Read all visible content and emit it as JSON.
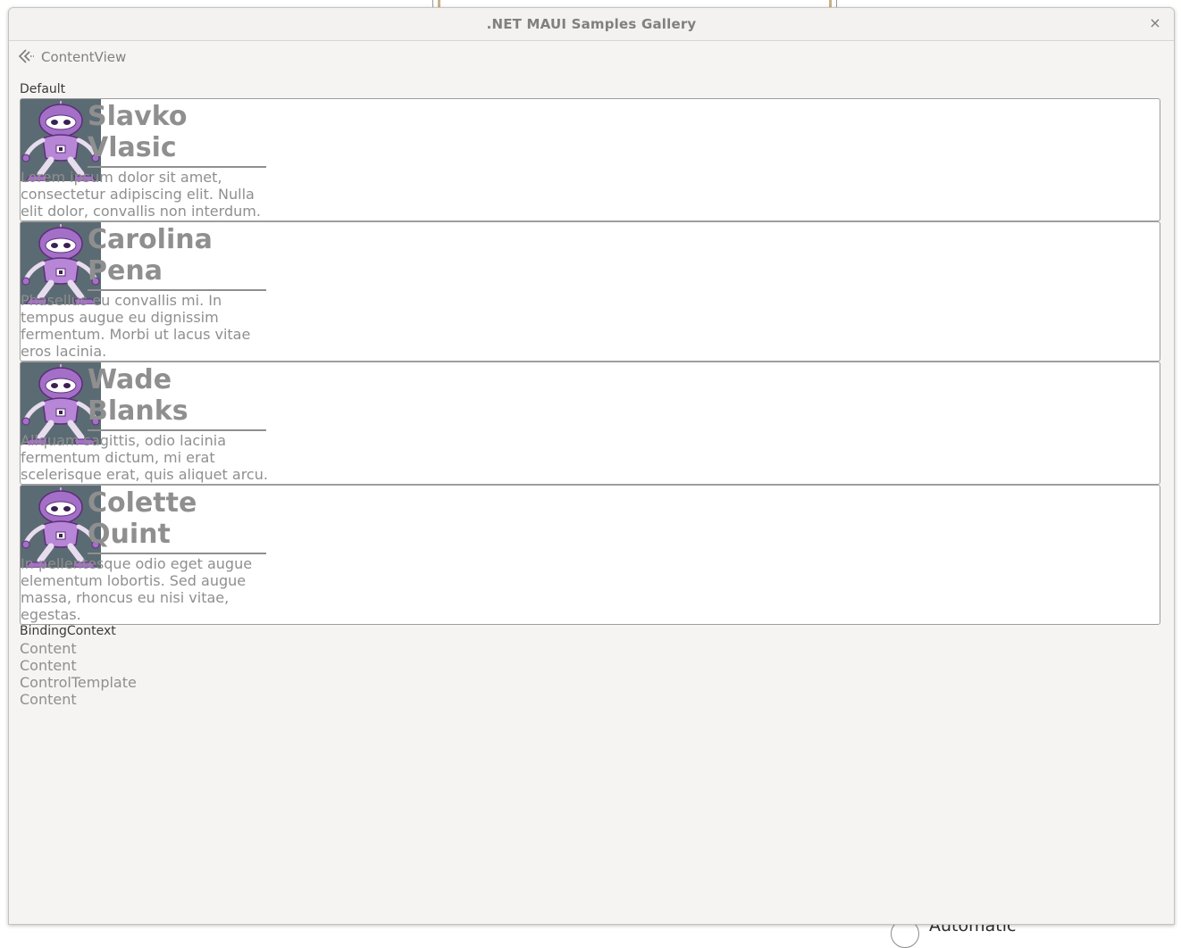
{
  "window": {
    "title": ".NET MAUI Samples Gallery",
    "close_symbol": "×"
  },
  "navigation": {
    "back_icon": "back-arrow-icon",
    "title": "ContentView"
  },
  "default_section": {
    "label": "Default",
    "cards": [
      {
        "name": "Slavko Vlasic",
        "description": "Lorem ipsum dolor sit amet, consectetur adipiscing elit. Nulla elit dolor, convallis non interdum.",
        "avatar_icon": "dotnet-bot-icon"
      },
      {
        "name": "Carolina Pena",
        "description": "Phasellus eu convallis mi. In tempus augue eu dignissim fermentum. Morbi ut lacus vitae eros lacinia.",
        "avatar_icon": "dotnet-bot-icon"
      },
      {
        "name": "Wade Blanks",
        "description": "Aliquam sagittis, odio lacinia fermentum dictum, mi erat scelerisque erat, quis aliquet arcu.",
        "avatar_icon": "dotnet-bot-icon"
      },
      {
        "name": "Colette Quint",
        "description": "In pellentesque odio eget augue elementum lobortis. Sed augue massa, rhoncus eu nisi vitae, egestas.",
        "avatar_icon": "dotnet-bot-icon"
      }
    ]
  },
  "binding_section": {
    "label": "BindingContext",
    "links": [
      "Content",
      "Content",
      "ControlTemplate",
      "Content"
    ]
  },
  "background": {
    "radio_label": "Automatic"
  }
}
